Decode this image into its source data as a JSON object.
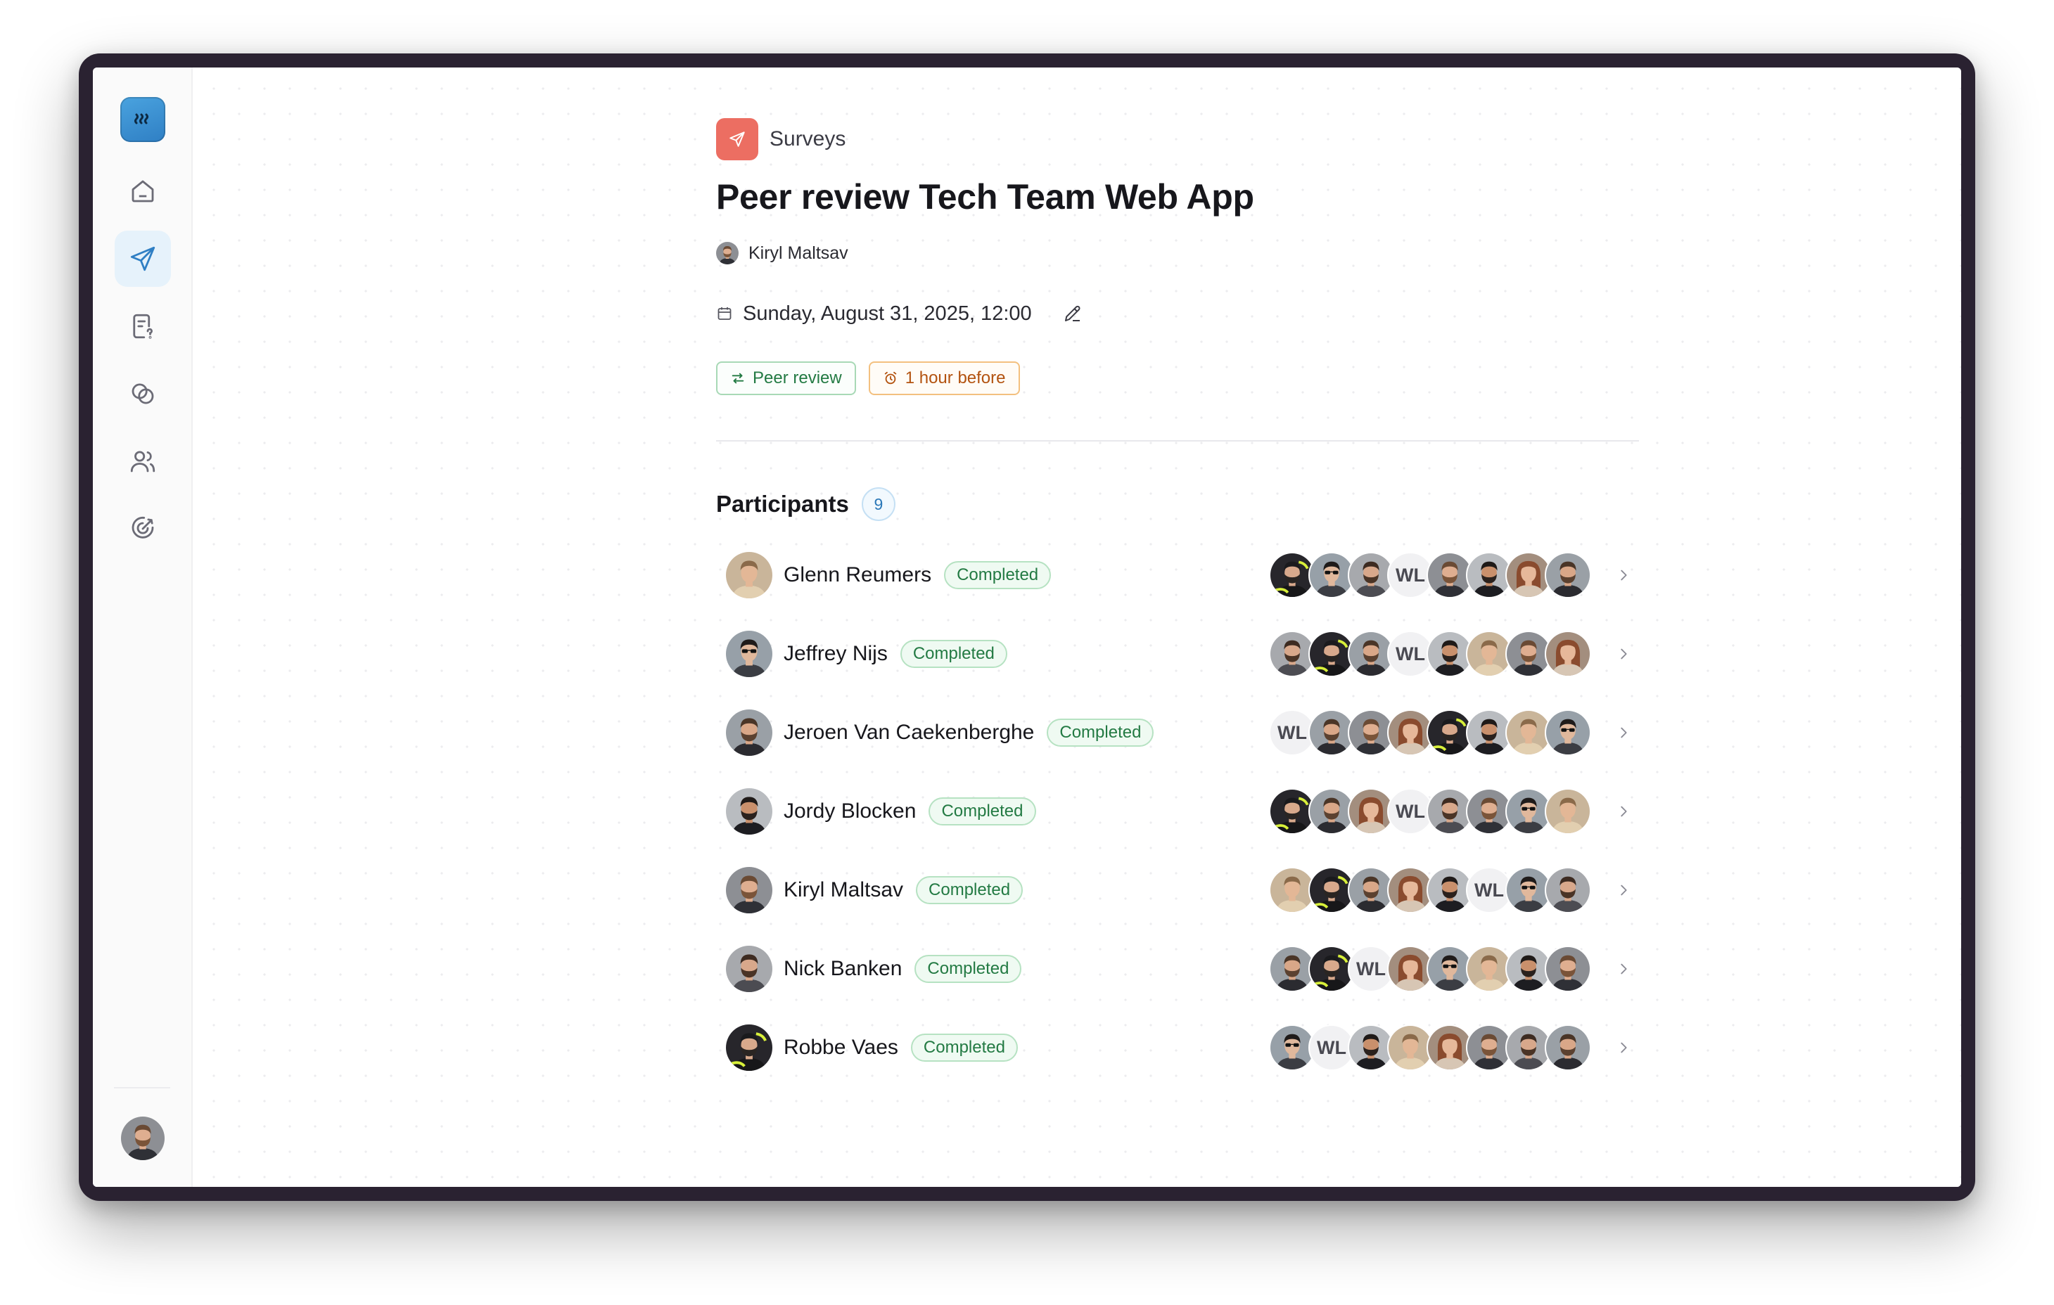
{
  "app": {
    "logo_icon": "logo-wave-icon"
  },
  "sidebar": {
    "items": [
      {
        "name": "home",
        "icon": "home-icon",
        "active": false
      },
      {
        "name": "surveys",
        "icon": "send-icon",
        "active": true
      },
      {
        "name": "forms",
        "icon": "document-question-icon",
        "active": false
      },
      {
        "name": "circles",
        "icon": "circles-icon",
        "active": false
      },
      {
        "name": "people",
        "icon": "users-icon",
        "active": false
      },
      {
        "name": "goals",
        "icon": "target-icon",
        "active": false
      }
    ]
  },
  "header": {
    "breadcrumb": "Surveys",
    "title": "Peer review Tech Team Web App",
    "author": "Kiryl Maltsav",
    "date": "Sunday, August 31, 2025, 12:00"
  },
  "tags": [
    {
      "label": "Peer review",
      "icon": "swap-arrows-icon",
      "color": "#237a43"
    },
    {
      "label": "1 hour before",
      "icon": "alarm-icon",
      "color": "#b35310"
    }
  ],
  "participants": {
    "title": "Participants",
    "count": "9",
    "rows": [
      {
        "name": "Glenn Reumers",
        "status": "Completed",
        "avatar": "b",
        "reviewers": [
          "f",
          "g",
          "c",
          "WL",
          "d",
          "e",
          "h",
          "a"
        ]
      },
      {
        "name": "Jeffrey Nijs",
        "status": "Completed",
        "avatar": "g",
        "reviewers": [
          "c",
          "f",
          "a",
          "WL",
          "e",
          "b",
          "d",
          "h"
        ]
      },
      {
        "name": "Jeroen Van Caekenberghe",
        "status": "Completed",
        "avatar": "a",
        "reviewers": [
          "WL",
          "a",
          "d",
          "h",
          "f",
          "e",
          "b",
          "g"
        ]
      },
      {
        "name": "Jordy Blocken",
        "status": "Completed",
        "avatar": "e",
        "reviewers": [
          "f",
          "a",
          "h",
          "WL",
          "c",
          "d",
          "g",
          "b"
        ]
      },
      {
        "name": "Kiryl Maltsav",
        "status": "Completed",
        "avatar": "d",
        "reviewers": [
          "b",
          "f",
          "a",
          "h",
          "e",
          "WL",
          "g",
          "c"
        ]
      },
      {
        "name": "Nick Banken",
        "status": "Completed",
        "avatar": "c",
        "reviewers": [
          "a",
          "f",
          "WL",
          "h",
          "g",
          "b",
          "e",
          "d"
        ]
      },
      {
        "name": "Robbe Vaes",
        "status": "Completed",
        "avatar": "f",
        "reviewers": [
          "g",
          "WL",
          "e",
          "b",
          "h",
          "d",
          "c",
          "a"
        ]
      }
    ]
  },
  "colors": {
    "accent": "#2f7fc4",
    "survey_icon_bg": "#ec6e62",
    "status_green": "#237a43"
  }
}
